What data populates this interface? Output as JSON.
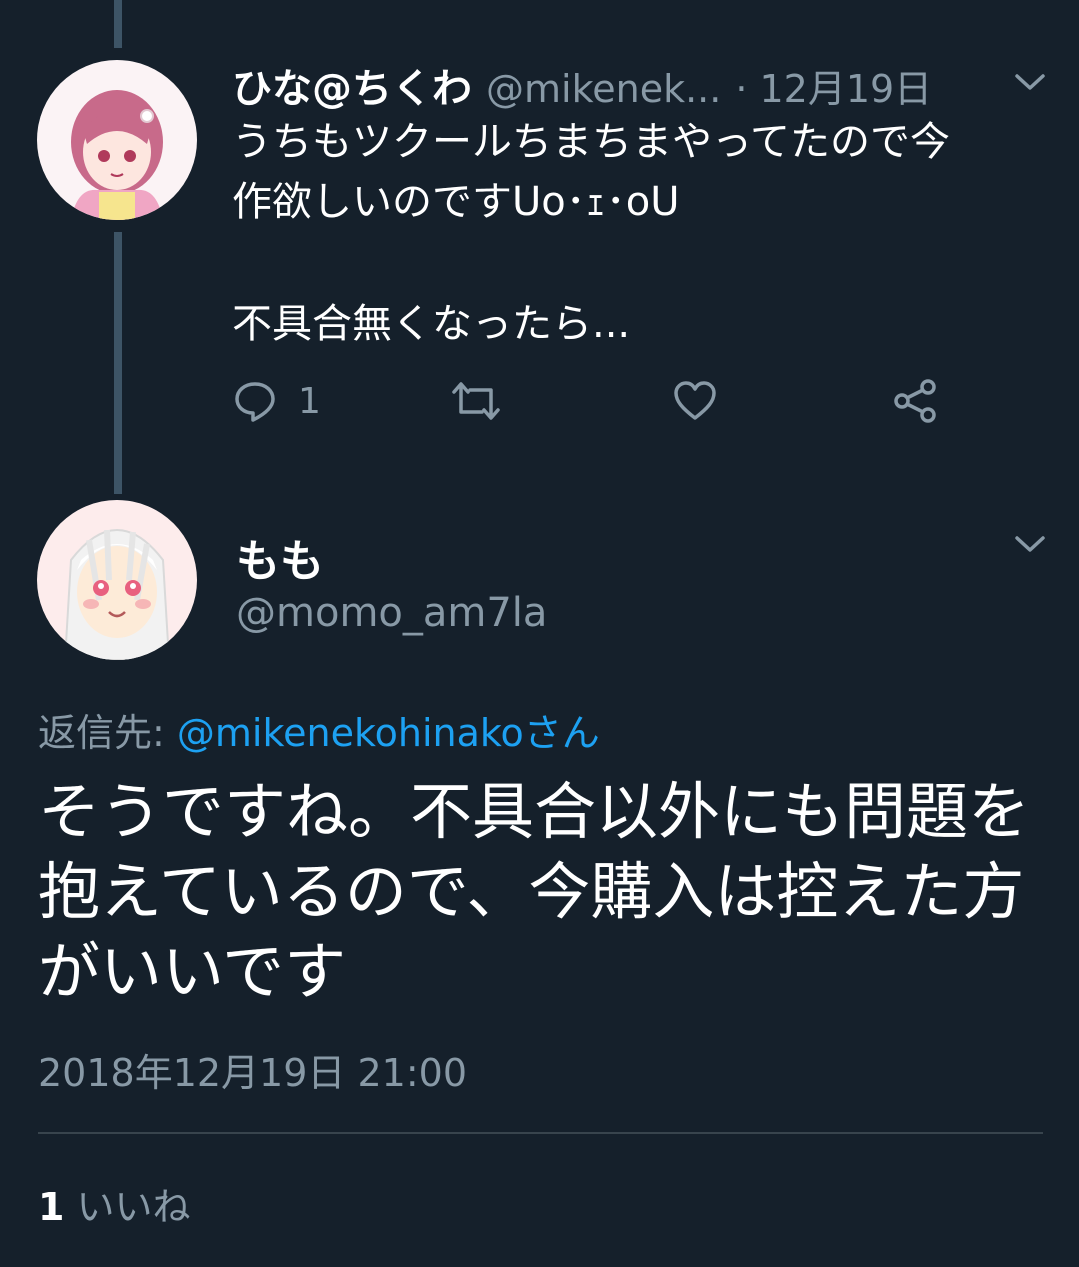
{
  "tweet1": {
    "display_name": "ひな@ちくわ",
    "handle": "@mikenek...",
    "date": "· 12月19日",
    "text_line1": "うちもツクールちまちまやってたので今",
    "text_line2": "作欲しいのですUo･ｪ･oU",
    "text_line3": "不具合無くなったら...",
    "reply_count": "1",
    "icons": [
      "menu-chevron-icon",
      "reply-icon",
      "retweet-icon",
      "like-icon",
      "share-icon"
    ]
  },
  "tweet2": {
    "display_name": "もも",
    "handle": "@momo_am7la",
    "reply_prefix": "返信先: ",
    "reply_target": "@mikenekohinakoさん",
    "text": "そうですね。不具合以外にも問題を抱えているので、今購入は控えた方がいいです",
    "timestamp": "2018年12月19日 21:00",
    "like_count": "1",
    "like_label": "いいね"
  },
  "colors": {
    "background": "#15202b",
    "secondary_text": "#8899a6",
    "link": "#1da1f2",
    "thread_line": "#3d5466"
  }
}
